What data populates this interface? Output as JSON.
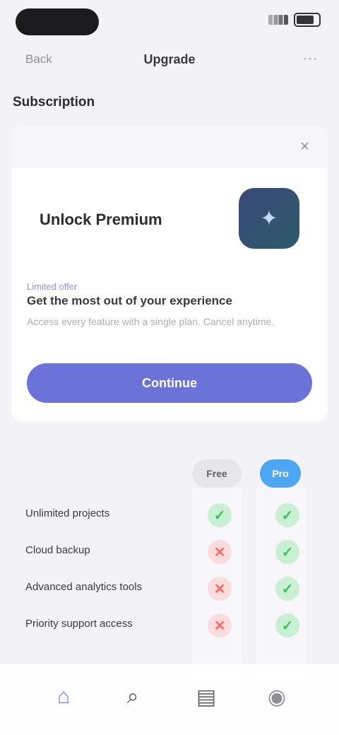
{
  "nav": {
    "back_label": "Back",
    "title": "Upgrade",
    "more_icon": "ellipsis-icon"
  },
  "section": {
    "title": "Subscription"
  },
  "promo": {
    "close_icon": "close-icon",
    "product_name": "Unlock Premium",
    "app_icon": "app-icon",
    "kicker": "Limited offer",
    "headline": "Get the most out of your experience",
    "body": "Access every feature with a single plan. Cancel anytime.",
    "cta_label": "Continue"
  },
  "compare": {
    "free_label": "Free",
    "pro_label": "Pro",
    "features": [
      {
        "label": "Unlimited projects",
        "free": "✓",
        "pro": "✓"
      },
      {
        "label": "Cloud backup",
        "free": "✕",
        "pro": "✓"
      },
      {
        "label": "Advanced analytics tools",
        "free": "✕",
        "pro": "✓"
      },
      {
        "label": "Priority support access",
        "free": "✕",
        "pro": "✓"
      }
    ]
  },
  "tabs": [
    {
      "name": "home",
      "icon": "home-icon",
      "glyph": "⌂"
    },
    {
      "name": "search",
      "icon": "search-icon",
      "glyph": "⌕"
    },
    {
      "name": "library",
      "icon": "library-icon",
      "glyph": "▤"
    },
    {
      "name": "profile",
      "icon": "profile-icon",
      "glyph": "◉"
    }
  ],
  "colors": {
    "accent": "#6b72d8",
    "pro_badge": "#4ea7f2",
    "check": "#34c759",
    "cross": "#ff6b6b"
  }
}
